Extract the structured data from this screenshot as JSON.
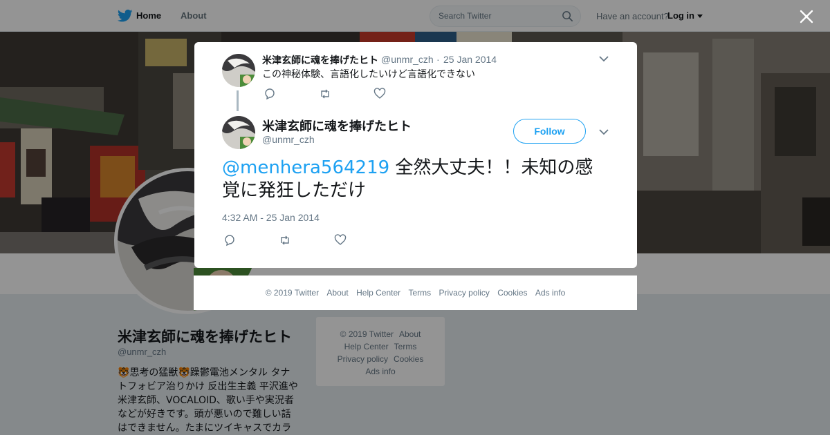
{
  "topbar": {
    "home_label": "Home",
    "about_label": "About",
    "search_placeholder": "Search Twitter",
    "have_account": "Have an account?",
    "login_label": "Log in"
  },
  "profile": {
    "name": "米津玄師に魂を捧げたヒト",
    "handle": "@unmr_czh",
    "bio_part1": "思考の猛獣",
    "bio_part2": "躁鬱電池メンタル タナトフォビア治りかけ 反出生主義 平沢進や米津玄師、VOCALOID、歌い手や実況者などが好きです。頭が悪いので難しい話はできません。たまにツイキャスでカラ"
  },
  "side_footer": {
    "copyright": "© 2019 Twitter",
    "about": "About",
    "help": "Help Center",
    "terms": "Terms",
    "privacy": "Privacy policy",
    "cookies": "Cookies",
    "ads": "Ads info"
  },
  "modal": {
    "parent": {
      "name": "米津玄師に魂を捧げたヒト",
      "handle": "@unmr_czh",
      "separator": "·",
      "date": "25 Jan 2014",
      "text": "この神秘体験、言語化したいけど言語化できない"
    },
    "main": {
      "name": "米津玄師に魂を捧げたヒト",
      "handle": "@unmr_czh",
      "follow_label": "Follow",
      "mention": "@menhera564219",
      "text": " 全然大丈夫！！未知の感覚に発狂しただけ",
      "timestamp": "4:32 AM - 25 Jan 2014"
    }
  },
  "modal_footer": {
    "copyright": "© 2019 Twitter",
    "about": "About",
    "help": "Help Center",
    "terms": "Terms",
    "privacy": "Privacy policy",
    "cookies": "Cookies",
    "ads": "Ads info"
  },
  "colors": {
    "accent": "#1da1f2",
    "muted": "#657786",
    "text": "#14171a"
  },
  "icons": [
    "twitter-bird-icon",
    "search-icon",
    "close-icon",
    "reply-icon",
    "retweet-icon",
    "like-icon",
    "chevron-down-icon"
  ]
}
